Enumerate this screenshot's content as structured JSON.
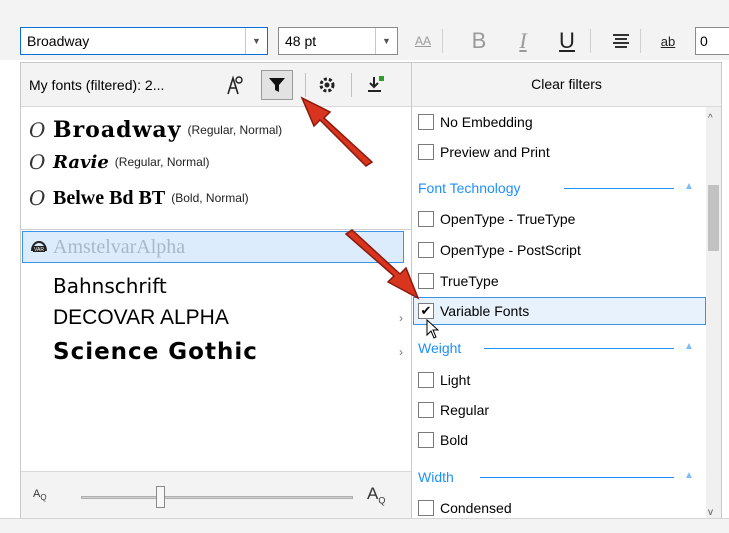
{
  "toolbar": {
    "font_name": "Broadway",
    "font_size": "48 pt",
    "underline_label": "U",
    "bold_label": "B",
    "italic_label": "I",
    "char_spacing_label": "AA",
    "ab_label": "ab",
    "ab_value": "0"
  },
  "font_list": {
    "title": "My fonts (filtered): 2...",
    "fonts": [
      {
        "name": "Broadway",
        "desc": "(Regular, Normal)"
      },
      {
        "name": "Ravie",
        "desc": "(Regular, Normal)"
      },
      {
        "name": "Belwe Bd BT",
        "desc": "(Bold, Normal)"
      }
    ],
    "variable_fonts": [
      {
        "name": "AmstelvarAlpha"
      },
      {
        "name": "Bahnschrift"
      },
      {
        "name": "DECOVAR ALPHA"
      },
      {
        "name": "Science Gothic"
      }
    ],
    "zoom_small_label": "A",
    "zoom_large_label": "A"
  },
  "filters": {
    "clear_label": "Clear filters",
    "embedding_items": [
      "No Embedding",
      "Preview and Print"
    ],
    "tech_section": "Font Technology",
    "tech_items": [
      "OpenType - TrueType",
      "OpenType - PostScript",
      "TrueType"
    ],
    "checked_item": "Variable Fonts",
    "weight_section": "Weight",
    "weight_items": [
      "Light",
      "Regular",
      "Bold"
    ],
    "width_section": "Width",
    "width_items": [
      "Condensed"
    ]
  },
  "colors": {
    "accent": "#1e90ff",
    "selection": "#dcecfc",
    "annotation_arrow": "#d9341e"
  }
}
